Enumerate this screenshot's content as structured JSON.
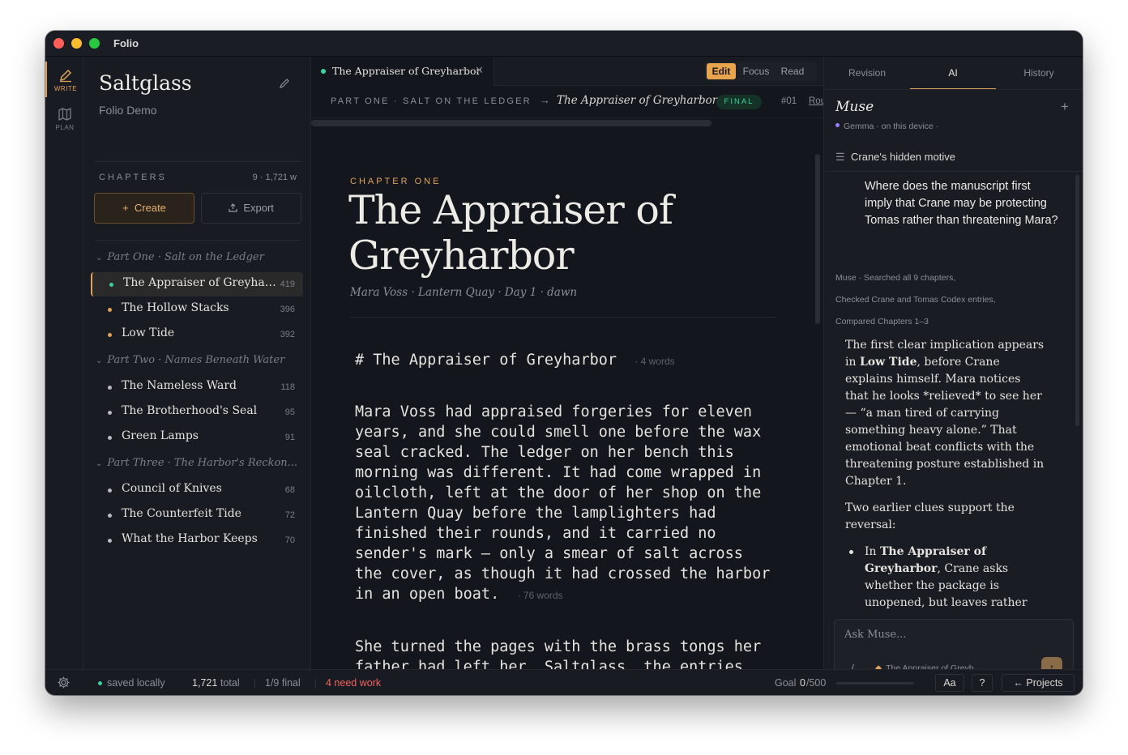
{
  "window": {
    "app_name": "Folio"
  },
  "rail": {
    "write_label": "WRITE",
    "plan_label": "PLAN"
  },
  "sidebar": {
    "project_title": "Saltglass",
    "project_subtitle": "Folio Demo",
    "chapters_label": "CHAPTERS",
    "chapters_count": "9 · 1,721 w",
    "create_label": "Create",
    "export_label": "Export",
    "parts": [
      {
        "label": "Part One · Salt on the Ledger"
      },
      {
        "label": "Part Two · Names Beneath Water"
      },
      {
        "label": "Part Three · The Harbor's Reckon..."
      }
    ],
    "chapters": [
      {
        "name": "The Appraiser of Greyharbor",
        "words": "419",
        "dot_color": "#3ad29f"
      },
      {
        "name": "The Hollow Stacks",
        "words": "396",
        "dot_color": "#e0a15a"
      },
      {
        "name": "Low Tide",
        "words": "392",
        "dot_color": "#e0a15a"
      },
      {
        "name": "The Nameless Ward",
        "words": "118",
        "dot_color": "#b9bac0"
      },
      {
        "name": "The Brotherhood's Seal",
        "words": "95",
        "dot_color": "#b9bac0"
      },
      {
        "name": "Green Lamps",
        "words": "91",
        "dot_color": "#b9bac0"
      },
      {
        "name": "Council of Knives",
        "words": "68",
        "dot_color": "#b9bac0"
      },
      {
        "name": "The Counterfeit Tide",
        "words": "72",
        "dot_color": "#b9bac0"
      },
      {
        "name": "What the Harbor Keeps",
        "words": "70",
        "dot_color": "#b9bac0"
      }
    ]
  },
  "editor": {
    "tab_label": "The Appraiser of Greyharbor",
    "modes": {
      "edit": "Edit",
      "focus": "Focus",
      "read": "Read"
    },
    "breadcrumb_part": "PART ONE · SALT ON THE LEDGER",
    "breadcrumb_chapter": "The Appraiser of Greyharbor",
    "status_badge": "FINAL",
    "chapter_number": "#01",
    "breadcrumb_more": "Rou",
    "kicker": "CHAPTER ONE",
    "title": "The Appraiser of Greyharbor",
    "meta": "Mara Voss · Lantern Quay · Day 1 · dawn",
    "heading_line": "# The Appraiser of Greyharbor",
    "heading_words": "· 4 words",
    "para1": "Mara Voss had appraised forgeries for eleven\nyears, and she could smell one before the wax\nseal cracked. The ledger on her bench this\nmorning was different. It had come wrapped in\noilcloth, left at the door of her shop on the\nLantern Quay before the lamplighters had\nfinished their rounds, and it carried no\nsender's mark — only a smear of salt across\nthe cover, as though it had crossed the harbor\nin an open boat.",
    "para1_words": "· 76 words",
    "para2": "She turned the pages with the brass tongs her\nfather had left her. Saltglass, the entries\ncalled themselves. Shipments of saltglass,"
  },
  "assistant": {
    "tabs": {
      "revision": "Revision",
      "ai": "AI",
      "history": "History"
    },
    "title": "Muse",
    "model": "Gemma · on this device ·",
    "thread": "Crane's hidden motive",
    "question": "Where does the manuscript first imply that Crane may be protecting Tomas rather than threatening Mara?",
    "steps": [
      "Muse ·  Searched all 9 chapters,",
      "Checked Crane and Tomas Codex entries,",
      "Compared Chapters 1–3"
    ],
    "answer_p1_a": "The first clear implication appears in ",
    "answer_p1_b": "Low Tide",
    "answer_p1_c": ", before Crane explains himself. Mara notices that he looks *relieved* to see her — “a man tired of carrying something heavy alone.” That emotional beat conflicts with the threatening posture established in Chapter 1.",
    "answer_p2": "Two earlier clues support the reversal:",
    "answer_li_a": "In ",
    "answer_li_b": "The Appraiser of Greyharbor",
    "answer_li_c": ", Crane asks whether the package is unopened, but leaves rather",
    "ask_placeholder": "Ask Muse...",
    "ask_context": "The Appraiser of Greyh..."
  },
  "status": {
    "saved": "saved locally",
    "total": "1,721",
    "total_suffix": "total",
    "final": "1/9 final",
    "need_work": "4 need work",
    "goal_label": "Goal",
    "goal_value": "0",
    "goal_target": "/500",
    "goal_progress": 0,
    "font_button": "Aa",
    "help_button": "?",
    "projects_button": "← Projects"
  }
}
